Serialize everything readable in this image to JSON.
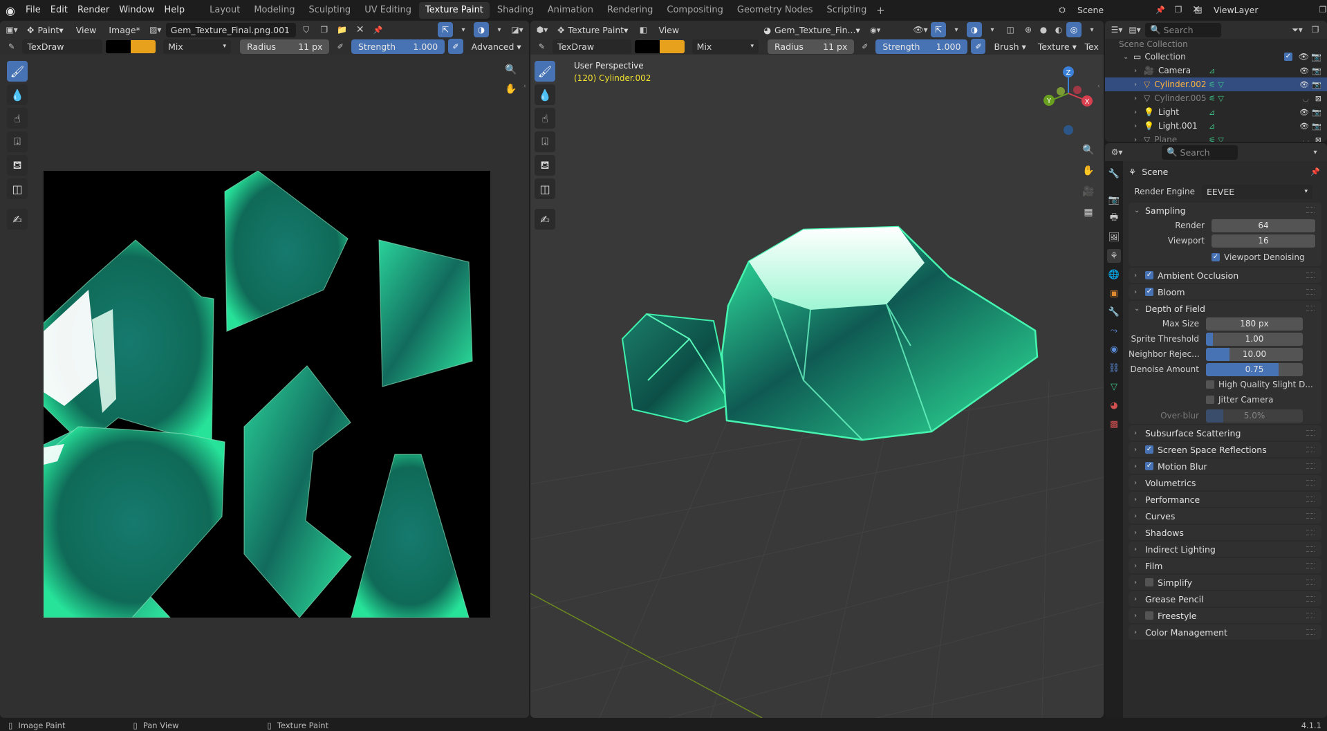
{
  "app": {
    "version": "4.1.1"
  },
  "menus": [
    "File",
    "Edit",
    "Render",
    "Window",
    "Help"
  ],
  "workspaces": [
    "Layout",
    "Modeling",
    "Sculpting",
    "UV Editing",
    "Texture Paint",
    "Shading",
    "Animation",
    "Rendering",
    "Compositing",
    "Geometry Nodes",
    "Scripting"
  ],
  "active_workspace": "Texture Paint",
  "scene_name": "Scene",
  "view_layer": "ViewLayer",
  "image_editor": {
    "mode": "Paint",
    "menu_view": "View",
    "menu_image": "Image*",
    "image_name": "Gem_Texture_Final.png.001",
    "tool_name": "TexDraw",
    "blend": "Mix",
    "radius_label": "Radius",
    "radius_value": "11 px",
    "strength_label": "Strength",
    "strength_value": "1.000",
    "advanced": "Advanced",
    "colors": {
      "primary": "#000000",
      "secondary": "#e8a11c"
    }
  },
  "viewport": {
    "mode": "Texture Paint",
    "menu_view": "View",
    "texture_name": "Gem_Texture_Fin...",
    "tool_name": "TexDraw",
    "blend": "Mix",
    "radius_label": "Radius",
    "radius_value": "11 px",
    "strength_label": "Strength",
    "strength_value": "1.000",
    "brush": "Brush",
    "texture": "Texture",
    "tex_short": "Tex",
    "perspective": "User Perspective",
    "object_info": "(120) Cylinder.002",
    "gizmo": {
      "x": "X",
      "y": "Y",
      "z": "Z"
    }
  },
  "outliner": {
    "search_placeholder": "Search",
    "root": "Scene Collection",
    "collection": "Collection",
    "items": [
      {
        "name": "Camera",
        "color": "#e0a060",
        "selected": false,
        "dim": false
      },
      {
        "name": "Cylinder.002",
        "color": "#e8a33c",
        "selected": true,
        "dim": false
      },
      {
        "name": "Cylinder.005",
        "color": "#9a9a9a",
        "selected": false,
        "dim": true
      },
      {
        "name": "Light",
        "color": "#e0a060",
        "selected": false,
        "dim": false
      },
      {
        "name": "Light.001",
        "color": "#e0a060",
        "selected": false,
        "dim": false
      },
      {
        "name": "Plane",
        "color": "#9a9a9a",
        "selected": false,
        "dim": true
      }
    ]
  },
  "properties": {
    "search_placeholder": "Search",
    "context": "Scene",
    "render_engine_label": "Render Engine",
    "render_engine": "EEVEE",
    "sampling": {
      "title": "Sampling",
      "render_label": "Render",
      "render_value": "64",
      "viewport_label": "Viewport",
      "viewport_value": "16",
      "denoise_label": "Viewport Denoising"
    },
    "ambient_occlusion": "Ambient Occlusion",
    "bloom": "Bloom",
    "dof": {
      "title": "Depth of Field",
      "rows": [
        {
          "label": "Max Size",
          "value": "180 px",
          "fill": 0
        },
        {
          "label": "Sprite Threshold",
          "value": "1.00",
          "fill": 0.07
        },
        {
          "label": "Neighbor Rejec...",
          "value": "10.00",
          "fill": 0.24
        },
        {
          "label": "Denoise Amount",
          "value": "0.75",
          "fill": 0.75
        }
      ],
      "hq_label": "High Quality Slight D...",
      "jitter_label": "Jitter Camera",
      "overblur_label": "Over-blur",
      "overblur_value": "5.0%"
    },
    "collapsed": [
      {
        "label": "Subsurface Scattering",
        "check": null
      },
      {
        "label": "Screen Space Reflections",
        "check": true
      },
      {
        "label": "Motion Blur",
        "check": true
      },
      {
        "label": "Volumetrics",
        "check": null
      },
      {
        "label": "Performance",
        "check": null
      },
      {
        "label": "Curves",
        "check": null
      },
      {
        "label": "Shadows",
        "check": null
      },
      {
        "label": "Indirect Lighting",
        "check": null
      },
      {
        "label": "Film",
        "check": null
      },
      {
        "label": "Simplify",
        "check": false
      },
      {
        "label": "Grease Pencil",
        "check": null
      },
      {
        "label": "Freestyle",
        "check": false
      },
      {
        "label": "Color Management",
        "check": null
      }
    ]
  },
  "status": {
    "left": "Image Paint",
    "mid": "Pan View",
    "right": "Texture Paint",
    "version": "4.1.1"
  }
}
